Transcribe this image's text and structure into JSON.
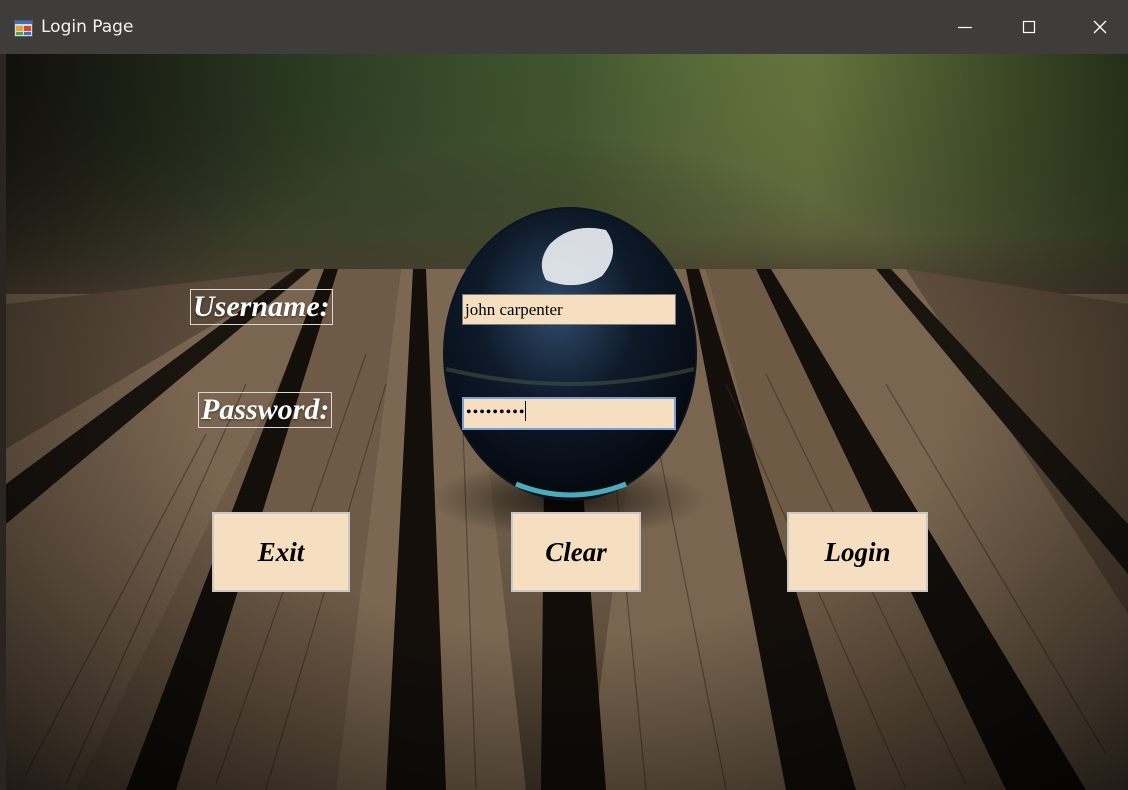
{
  "window": {
    "title": "Login Page",
    "controls": {
      "minimize_icon": "minimize-icon",
      "maximize_icon": "maximize-icon",
      "close_icon": "close-icon"
    }
  },
  "form": {
    "username_label": "Username:",
    "username_value": "john carpenter",
    "password_label": "Password:",
    "password_mask": "•••••••••"
  },
  "buttons": {
    "exit": "Exit",
    "clear": "Clear",
    "login": "Login"
  },
  "colors": {
    "titlebar": "#3f3d3b",
    "field_bg": "#f5dfc0",
    "button_bg": "#f5dfc0"
  }
}
